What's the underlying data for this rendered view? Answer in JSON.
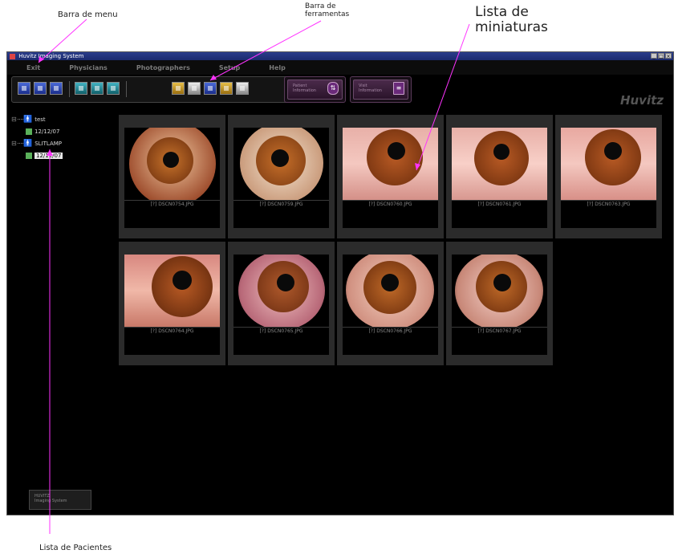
{
  "callouts": {
    "menu_bar": "Barra de menu",
    "toolbar_line1": "Barra de",
    "toolbar_line2": "ferramentas",
    "thumbnails_line1": "Lista de",
    "thumbnails_line2": "miniaturas",
    "patients": "Lista de Pacientes"
  },
  "window": {
    "title": "Huvitz Imaging System",
    "controls": [
      "_",
      "□",
      "×"
    ]
  },
  "menu": [
    "Exit",
    "Physicians",
    "Photographers",
    "Setup",
    "Help"
  ],
  "toolbar": {
    "patient_button": "Patient Information",
    "visit_button": "Visit Information"
  },
  "brand": "Huvitz",
  "tree": {
    "patients": [
      {
        "name": "test",
        "visits": [
          "12/12/07"
        ]
      },
      {
        "name": "SLITLAMP",
        "visits": [
          "12/12/07"
        ]
      }
    ]
  },
  "thumbnails": [
    {
      "caption": "[?] DSCN0754.JPG"
    },
    {
      "caption": "[?] DSCN0759.JPG"
    },
    {
      "caption": "[?] DSCN0760.JPG"
    },
    {
      "caption": "[?] DSCN0761.JPG"
    },
    {
      "caption": "[?] DSCN0763.JPG"
    },
    {
      "caption": "[?] DSCN0764.JPG"
    },
    {
      "caption": "[?] DSCN0765.JPG"
    },
    {
      "caption": "[?] DSCN0766.JPG"
    },
    {
      "caption": "[?] DSCN0767.JPG"
    }
  ],
  "status": {
    "line1": "HUVITZ",
    "line2": "Imaging System"
  },
  "colors": {
    "callout_line": "#ff33ff",
    "background": "#000000",
    "iris": "#b4541c"
  }
}
